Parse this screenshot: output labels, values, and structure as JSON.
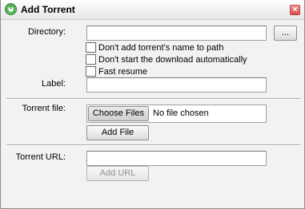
{
  "dialog": {
    "title": "Add Torrent",
    "close_label": "×"
  },
  "directory": {
    "label": "Directory:",
    "value": "",
    "browse_label": "..."
  },
  "options": [
    {
      "label": "Don't add torrent's name to path",
      "checked": false
    },
    {
      "label": "Don't start the download automatically",
      "checked": false
    },
    {
      "label": "Fast resume",
      "checked": false
    }
  ],
  "label_field": {
    "label": "Label:",
    "value": ""
  },
  "torrent_file": {
    "label": "Torrent file:",
    "choose_label": "Choose Files",
    "status": "No file chosen",
    "add_label": "Add File"
  },
  "torrent_url": {
    "label": "Torrent URL:",
    "value": "",
    "add_label": "Add URL"
  },
  "colors": {
    "title_icon": "#4aa84a",
    "close": "#d84a4a"
  }
}
